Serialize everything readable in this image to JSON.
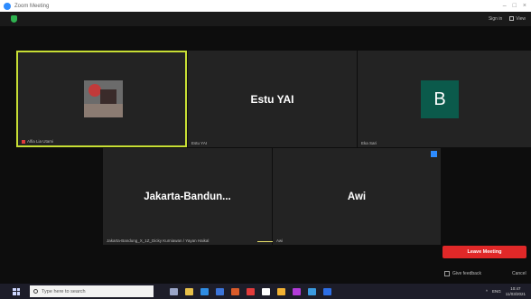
{
  "window": {
    "title": "Zoom Meeting"
  },
  "toolbar": {
    "signin_label": "Sign in",
    "view_label": "View"
  },
  "participants": [
    {
      "name_label": "Alfia Lia Utami"
    },
    {
      "display_name": "Estu YAI",
      "name_label": "Estu YAI"
    },
    {
      "avatar_letter": "B",
      "name_label": "Eka Sari"
    },
    {
      "display_name": "Jakarta-Bandun...",
      "name_label": "Jakarta-Bandung_X_1Z_Dicky Kurniawan / Yayan Haikal"
    },
    {
      "display_name": "Awi",
      "name_label": "Awi"
    }
  ],
  "controls": {
    "leave_meeting": "Leave Meeting",
    "give_feedback": "Give feedback",
    "cancel": "Cancel"
  },
  "taskbar": {
    "search_placeholder": "Type here to search",
    "language": "ENG",
    "time": "10:47",
    "date": "11/03/2021"
  },
  "colors": {
    "accent_active": "#c7de34",
    "leave": "#e02828",
    "avatar_bg": "#0b5a4b"
  }
}
